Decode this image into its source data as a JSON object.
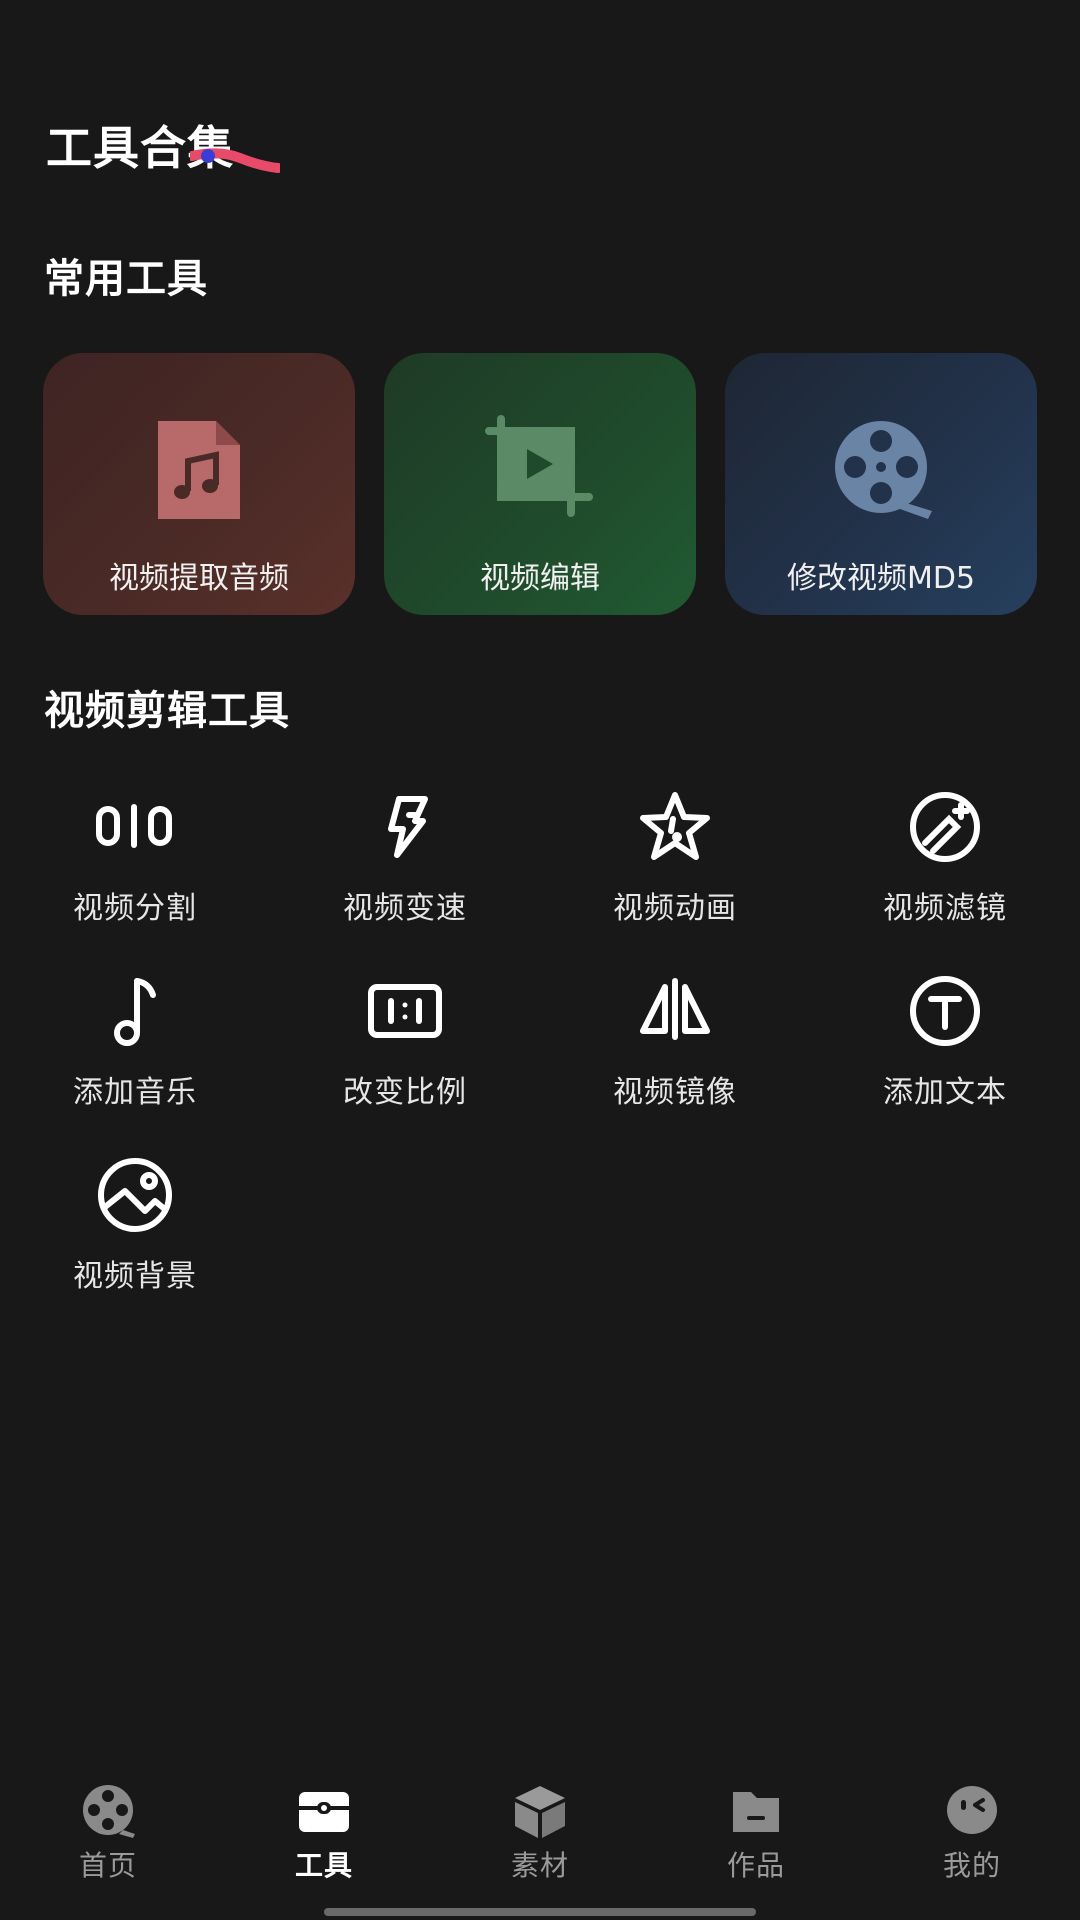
{
  "page": {
    "title": "工具合集"
  },
  "sections": {
    "common_title": "常用工具",
    "edit_title": "视频剪辑工具"
  },
  "featured": [
    {
      "label": "视频提取音频",
      "icon": "audio-file-icon"
    },
    {
      "label": "视频编辑",
      "icon": "crop-play-icon"
    },
    {
      "label": "修改视频MD5",
      "icon": "film-reel-icon"
    }
  ],
  "tools": [
    {
      "label": "视频分割",
      "icon": "split-icon"
    },
    {
      "label": "视频变速",
      "icon": "speed-icon"
    },
    {
      "label": "视频动画",
      "icon": "animation-star-icon"
    },
    {
      "label": "视频滤镜",
      "icon": "filter-icon"
    },
    {
      "label": "添加音乐",
      "icon": "music-note-icon"
    },
    {
      "label": "改变比例",
      "icon": "ratio-icon"
    },
    {
      "label": "视频镜像",
      "icon": "mirror-icon"
    },
    {
      "label": "添加文本",
      "icon": "text-icon"
    },
    {
      "label": "视频背景",
      "icon": "background-image-icon"
    }
  ],
  "nav": {
    "active_index": 1,
    "items": [
      {
        "label": "首页",
        "icon": "film-reel-icon"
      },
      {
        "label": "工具",
        "icon": "toolbox-icon"
      },
      {
        "label": "素材",
        "icon": "cube-icon"
      },
      {
        "label": "作品",
        "icon": "folder-icon"
      },
      {
        "label": "我的",
        "icon": "profile-face-icon"
      }
    ]
  },
  "colors": {
    "background": "#181818",
    "card_audio": "#4a2a26",
    "card_edit": "#1f4a2b",
    "card_md5": "#22324a",
    "nav_inactive": "#9a9a9a",
    "nav_active": "#ffffff"
  }
}
